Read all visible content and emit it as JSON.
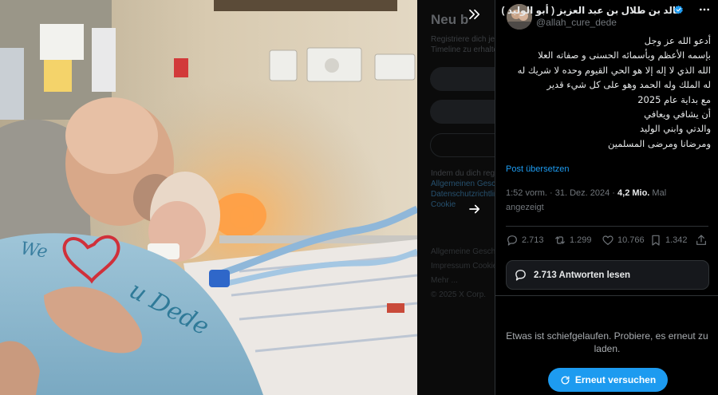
{
  "tweet": {
    "display_name": "خالد بن طلال بن عبد العزيز ( أبو الوليد )",
    "handle": "@allah_cure_dede",
    "text_lines": [
      "أدعو الله عز وجل",
      "بإسمه الأعظم وبأسمائه الحسنى و صفاته العلا",
      "الله الذي لا إله إلا هو الحي القيوم وحده لا شريك له",
      "له الملك وله الحمد وهو على كل شيء قدير",
      "مع بداية عام 2025",
      "أن يشافي ويعافي",
      "والدتي وابني الوليد",
      "ومرضانا ومرضى المسلمين"
    ],
    "translate_label": "Post übersetzen",
    "timestamp": "1:52 vorm. · 31. Dez. 2024 ·",
    "views_count": "4,2 Mio.",
    "views_label": "Mal angezeigt",
    "stats": {
      "replies": "2.713",
      "reposts": "1.299",
      "likes": "10.766",
      "bookmarks": "1.342"
    },
    "read_replies_label": "2.713 Antworten lesen",
    "error_message": "Etwas ist schiefgelaufen. Probiere, es erneut zu laden.",
    "retry_label": "Erneut versuchen"
  },
  "background_panel": {
    "title": "Neu b",
    "subtitle_lines": [
      "Registriere dich jetzt",
      "Timeline zu erhalten"
    ],
    "link_lines": [
      "Indem du dich registrierst",
      "Allgemeinen Geschäfts",
      "Datenschutzrichtlinie",
      "Cookie"
    ],
    "footer_lines": [
      "Allgemeine Geschäfts",
      "Impressum Cookie",
      "Mehr ...",
      "© 2025 X Corp."
    ]
  },
  "photo": {
    "caption_text": "We ❤ u Dede"
  },
  "colors": {
    "accent": "#1d9bf0",
    "background": "#000000",
    "border": "#2f3336",
    "secondary_text": "#71767b"
  },
  "icons": [
    "collapse-icon",
    "next-arrow-icon",
    "verified-badge-icon",
    "more-icon",
    "reply-icon",
    "repost-icon",
    "like-icon",
    "bookmark-icon",
    "share-icon",
    "chat-bubble-icon",
    "refresh-icon"
  ]
}
